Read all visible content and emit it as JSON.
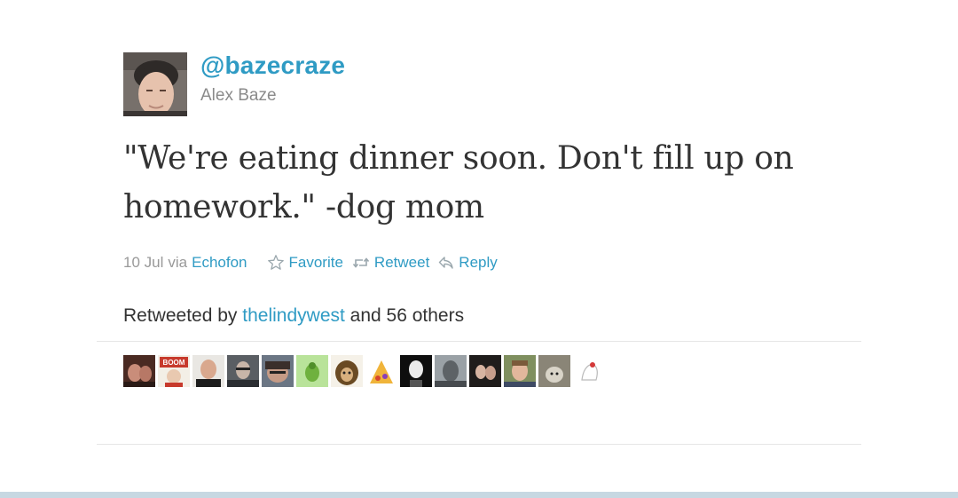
{
  "tweet": {
    "handle": "@bazecraze",
    "name": "Alex Baze",
    "text": "\"We're eating dinner soon. Don't fill up on homework.\" -dog mom",
    "date": "10 Jul",
    "via_label": "via",
    "client": "Echofon",
    "actions": {
      "favorite": "Favorite",
      "retweet": "Retweet",
      "reply": "Reply"
    }
  },
  "retweets": {
    "prefix": "Retweeted by",
    "user": "thelindywest",
    "suffix": "and 56 others",
    "avatar_badge_text": "BOOM"
  },
  "colors": {
    "link": "#2f9bc4",
    "text": "#333333",
    "muted": "#999999",
    "bottom_bar": "#c7d8e2"
  }
}
